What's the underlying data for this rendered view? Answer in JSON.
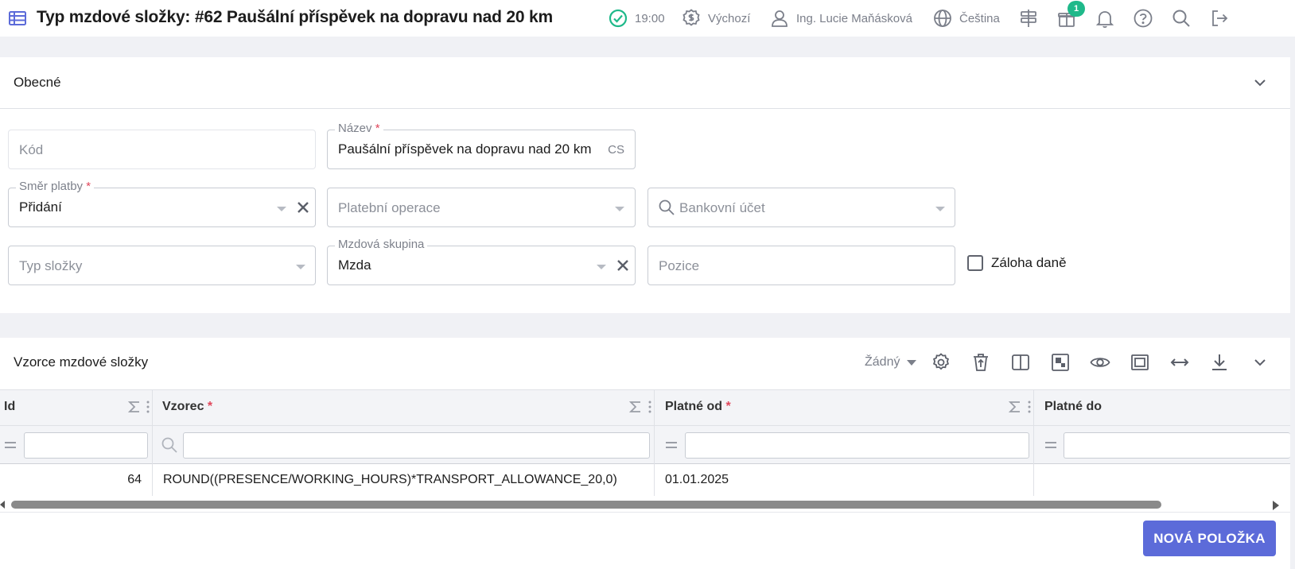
{
  "header": {
    "title": "Typ mzdové složky: #62 Paušální příspěvek na dopravu nad 20 km",
    "time": "19:00",
    "currency_profile": "Výchozí",
    "user": "Ing. Lucie Maňásková",
    "language": "Čeština",
    "gift_badge_count": "1"
  },
  "general": {
    "title": "Obecné",
    "fields": {
      "code": {
        "placeholder": "Kód"
      },
      "name": {
        "label": "Název",
        "required_mark": "*",
        "value": "Paušální příspěvek na dopravu nad 20  km",
        "suffix": "CS"
      },
      "payment_direction": {
        "label": "Směr platby",
        "required_mark": "*",
        "value": "Přidání"
      },
      "payment_operation": {
        "placeholder": "Platební operace"
      },
      "bank_account": {
        "placeholder": "Bankovní účet"
      },
      "component_type": {
        "placeholder": "Typ složky"
      },
      "wage_group": {
        "label": "Mzdová skupina",
        "value": "Mzda"
      },
      "position": {
        "placeholder": "Pozice"
      },
      "tax_advance": {
        "label": "Záloha daně",
        "checked": false
      }
    }
  },
  "formulas": {
    "title": "Vzorce mzdové složky",
    "grouping_select": "Žádný",
    "columns": [
      {
        "label": "Id",
        "required_mark": ""
      },
      {
        "label": "Vzorec",
        "required_mark": "*"
      },
      {
        "label": "Platné od",
        "required_mark": "*"
      },
      {
        "label": "Platné do",
        "required_mark": ""
      }
    ],
    "rows": [
      {
        "id": "64",
        "formula": "ROUND((PRESENCE/WORKING_HOURS)*TRANSPORT_ALLOWANCE_20,0)",
        "valid_from": "01.01.2025",
        "valid_to": ""
      }
    ],
    "new_item_label": "NOVÁ POLOŽKA"
  },
  "colors": {
    "accent": "#5c6bd9",
    "success": "#1fb98a",
    "required": "#e0475b"
  }
}
